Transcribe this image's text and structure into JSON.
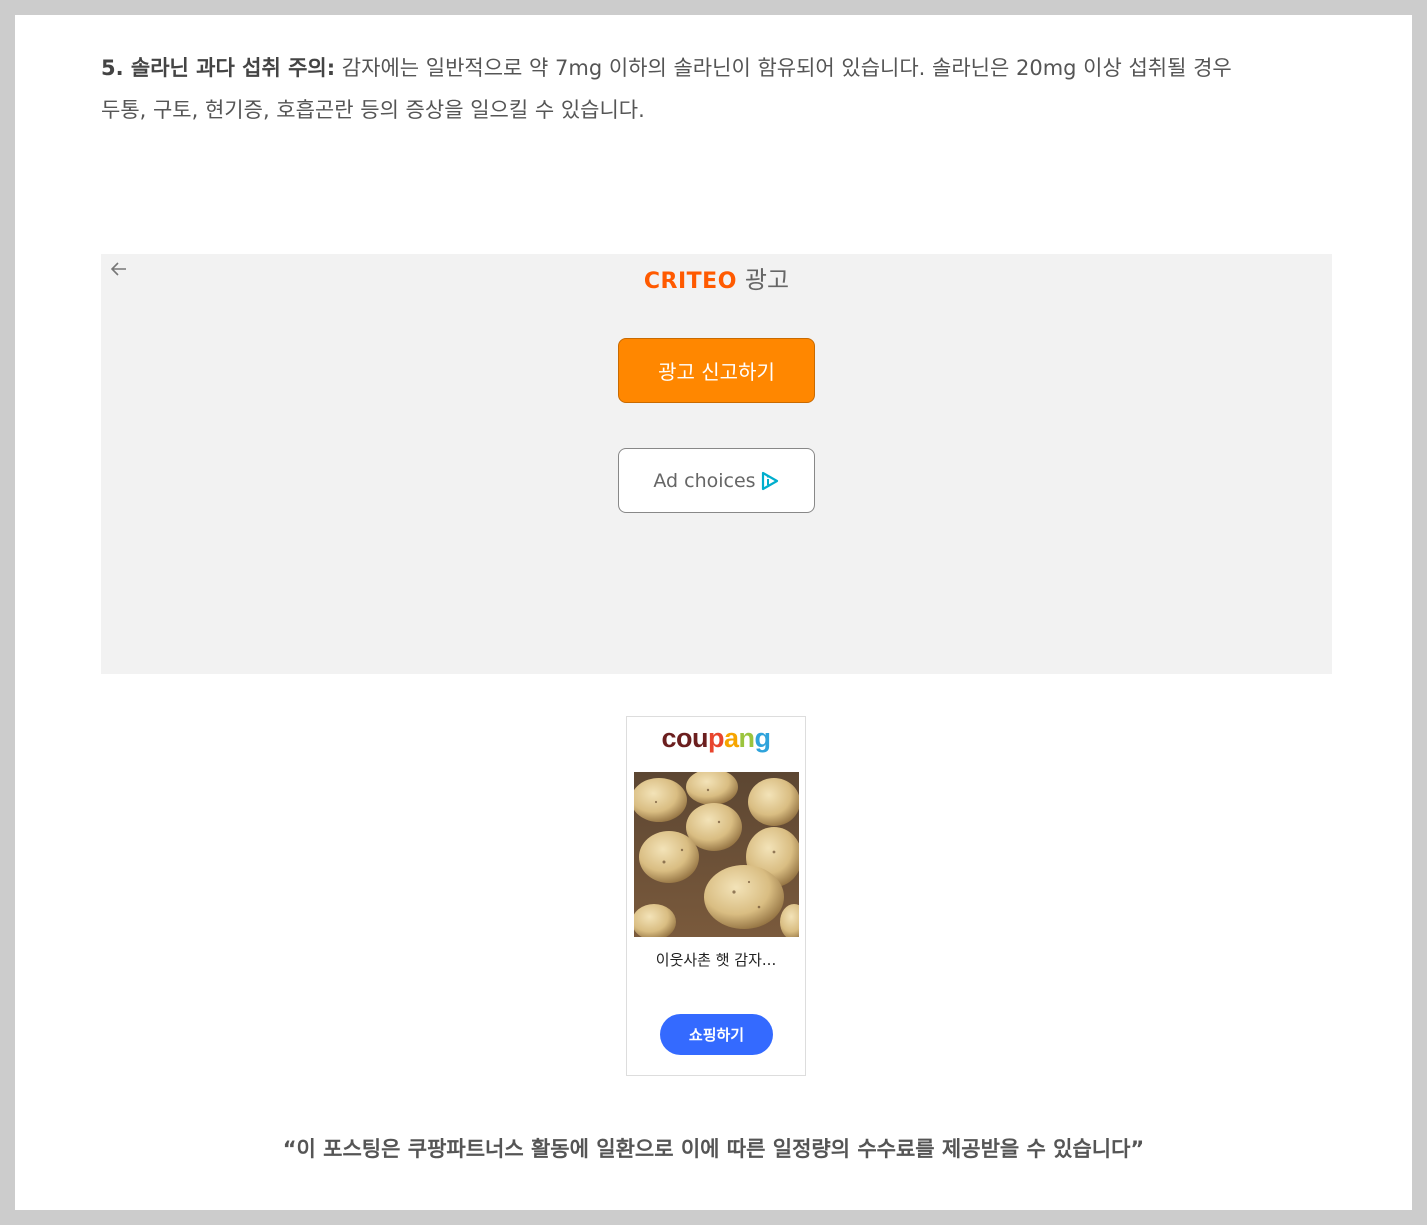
{
  "article": {
    "heading": "5. 솔라닌 과다 섭취 주의:",
    "body_line1": " 감자에는 일반적으로 약 7mg 이하의 솔라닌이 함유되어 있습니다. 솔라닌은 20mg 이상 섭취될 경우",
    "body_line2": "두통, 구토, 현기증, 호흡곤란 등의 증상을 일으킬 수 있습니다."
  },
  "criteo_ad": {
    "logo_text": "CRITEO",
    "ad_label": "광고",
    "back_icon": "arrow-left-icon",
    "report_button": "광고 신고하기",
    "adchoices_button": "Ad choices",
    "colors": {
      "brand": "#ff5a00",
      "report_bg": "#ff8700",
      "panel_bg": "#f2f2f2",
      "adchoices": "#00aecd"
    }
  },
  "coupang_ad": {
    "logo_letters": [
      "c",
      "o",
      "u",
      "p",
      "a",
      "n",
      "g"
    ],
    "logo_colors": [
      "#6b1e1e",
      "#6b1e1e",
      "#6b1e1e",
      "#e8452d",
      "#f6a500",
      "#9bc43d",
      "#2fa3db"
    ],
    "product_name": "이웃사촌 햇 감자...",
    "shop_button": "쇼핑하기",
    "button_color": "#346aff"
  },
  "disclosure": "“이 포스팅은 쿠팡파트너스 활동에 일환으로 이에 따른 일정량의 수수료를 제공받을 수 있습니다”"
}
